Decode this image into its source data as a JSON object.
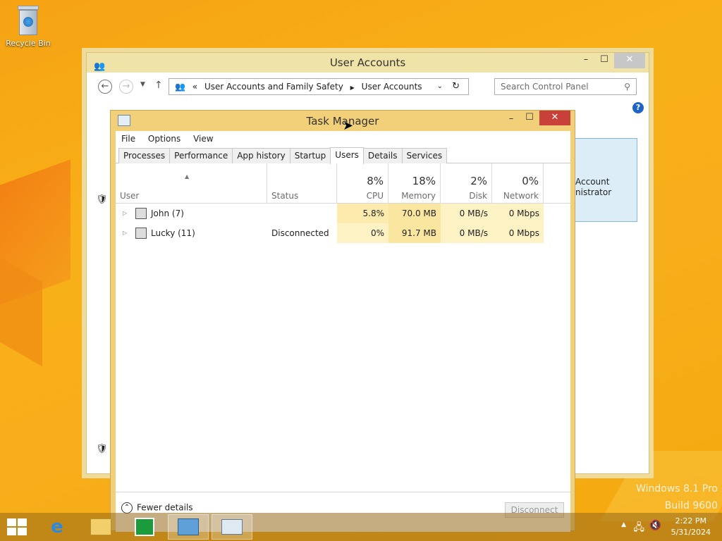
{
  "desktop": {
    "recycle_bin_label": "Recycle Bin",
    "watermark_line1": "Windows 8.1 Pro",
    "watermark_line2": "Build 9600"
  },
  "user_accounts": {
    "title": "User Accounts",
    "breadcrumb_sep": "«",
    "breadcrumb": [
      "User Accounts and Family Safety",
      "User Accounts"
    ],
    "search_placeholder": "Search Control Panel",
    "account_box_line1": "Account",
    "account_box_line2": "nistrator"
  },
  "task_manager": {
    "title": "Task Manager",
    "menu": [
      "File",
      "Options",
      "View"
    ],
    "tabs": [
      "Processes",
      "Performance",
      "App history",
      "Startup",
      "Users",
      "Details",
      "Services"
    ],
    "active_tab": "Users",
    "columns": {
      "user": "User",
      "status": "Status",
      "cpu": {
        "pct": "8%",
        "name": "CPU"
      },
      "memory": {
        "pct": "18%",
        "name": "Memory"
      },
      "disk": {
        "pct": "2%",
        "name": "Disk"
      },
      "network": {
        "pct": "0%",
        "name": "Network"
      }
    },
    "rows": [
      {
        "name": "John (7)",
        "status": "",
        "cpu": "5.8%",
        "memory": "70.0 MB",
        "disk": "0 MB/s",
        "network": "0 Mbps"
      },
      {
        "name": "Lucky (11)",
        "status": "Disconnected",
        "cpu": "0%",
        "memory": "91.7 MB",
        "disk": "0 MB/s",
        "network": "0 Mbps"
      }
    ],
    "fewer_details": "Fewer details",
    "disconnect_button": "Disconnect"
  },
  "taskbar": {
    "time": "2:22 PM",
    "date": "5/31/2024"
  },
  "colors": {
    "cpu_heat": "#fdf0b6",
    "mem_heat": "#fcebad",
    "accent_frame": "#f2d07a"
  }
}
